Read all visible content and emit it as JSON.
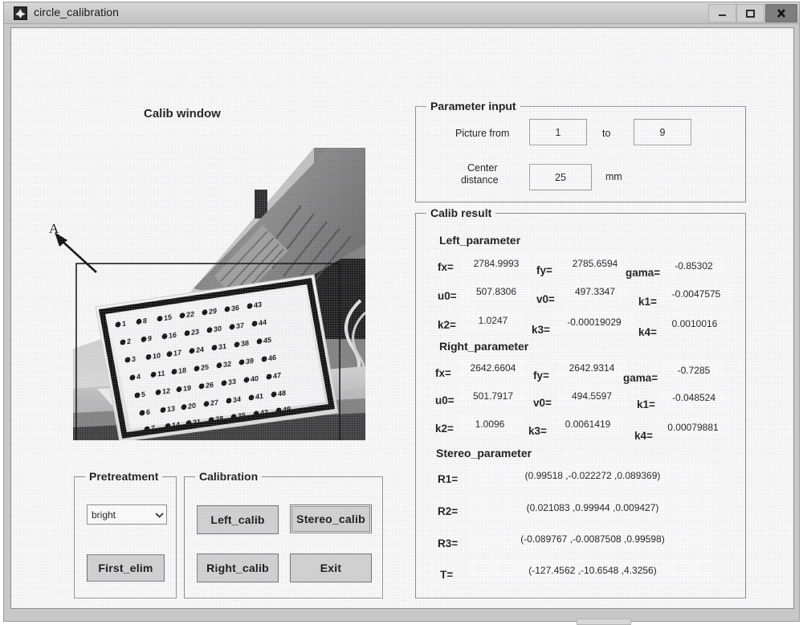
{
  "window": {
    "title": "circle_calibration",
    "icon": "matlab-icon",
    "controls": {
      "minimize": "minimize-icon",
      "maximize": "maximize-icon",
      "close": "close-icon"
    }
  },
  "calib_window": {
    "title": "Calib window",
    "annotation_label": "A"
  },
  "parameter_input": {
    "title": "Parameter input",
    "picture_from_label": "Picture from",
    "picture_from_value": "1",
    "to_label": "to",
    "picture_to_value": "9",
    "center_distance_label_line1": "Center",
    "center_distance_label_line2": "distance",
    "center_distance_value": "25",
    "unit_label": "mm"
  },
  "calib_result": {
    "title": "Calib result",
    "left_parameter": {
      "title": "Left_parameter",
      "rows": [
        [
          {
            "label": "fx=",
            "value": "2784.9993"
          },
          {
            "label": "fy=",
            "value": "2785.6594"
          },
          {
            "label": "gama=",
            "value": "-0.85302"
          }
        ],
        [
          {
            "label": "u0=",
            "value": "507.8306"
          },
          {
            "label": "v0=",
            "value": "497.3347"
          },
          {
            "label": "k1=",
            "value": "-0.0047575"
          }
        ],
        [
          {
            "label": "k2=",
            "value": "1.0247"
          },
          {
            "label": "k3=",
            "value": "-0.00019029"
          },
          {
            "label": "k4=",
            "value": "0.0010016"
          }
        ]
      ]
    },
    "right_parameter": {
      "title": "Right_parameter",
      "rows": [
        [
          {
            "label": "fx=",
            "value": "2642.6604"
          },
          {
            "label": "fy=",
            "value": "2642.9314"
          },
          {
            "label": "gama=",
            "value": "-0.7285"
          }
        ],
        [
          {
            "label": "u0=",
            "value": "501.7917"
          },
          {
            "label": "v0=",
            "value": "494.5597"
          },
          {
            "label": "k1=",
            "value": "-0.048524"
          }
        ],
        [
          {
            "label": "k2=",
            "value": "1.0096"
          },
          {
            "label": "k3=",
            "value": "0.0061419"
          },
          {
            "label": "k4=",
            "value": "0.00079881"
          }
        ]
      ]
    },
    "stereo_parameter": {
      "title": "Stereo_parameter",
      "rows": [
        {
          "label": "R1=",
          "value": "(0.99518 ,-0.022272 ,0.089369)"
        },
        {
          "label": "R2=",
          "value": "(0.021083 ,0.99944 ,0.009427)"
        },
        {
          "label": "R3=",
          "value": "(-0.089767 ,-0.0087508 ,0.99598)"
        },
        {
          "label": "T=",
          "value": "(-127.4562 ,-10.6548 ,4.3256)"
        }
      ]
    }
  },
  "pretreatment": {
    "title": "Pretreatment",
    "dropdown_value": "bright",
    "dropdown_icon": "chevron-down-icon",
    "first_elim_button": "First_elim"
  },
  "calibration": {
    "title": "Calibration",
    "left_calib_button": "Left_calib",
    "stereo_calib_button": "Stereo_calib",
    "right_calib_button": "Right_calib",
    "exit_button": "Exit"
  },
  "colors": {
    "window_frame": "#c8c8c8",
    "client_bg": "#fbfbfb",
    "button_face": "#d2d2d2",
    "close_button": "#7e7e7e",
    "text": "#161616"
  }
}
